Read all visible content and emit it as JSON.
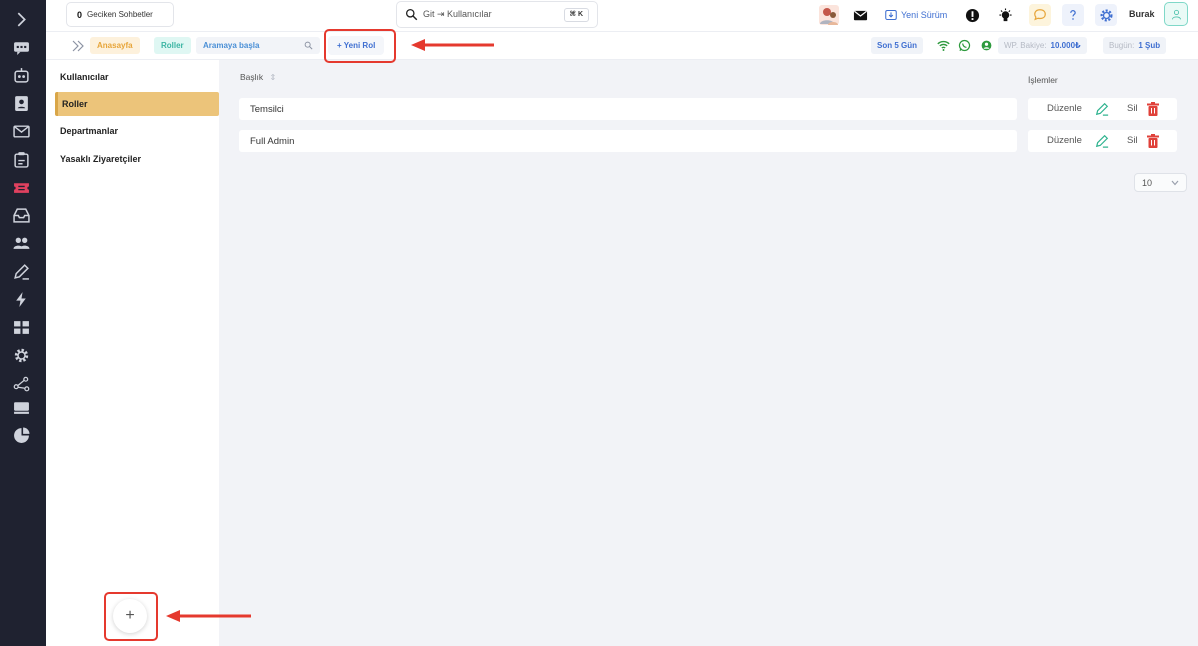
{
  "topbar": {
    "late_chats_count": "0",
    "late_chats_label": "Geciken Sohbetler",
    "search_placeholder": "Git ⇥ Kullanıcılar",
    "search_shortcut": "⌘ K",
    "new_version_label": "Yeni Sürüm",
    "user_name": "Burak"
  },
  "breadcrumb": {
    "home": "Anasayfa",
    "current": "Roller",
    "search_placeholder": "Aramaya başla",
    "new_role_label": "+ Yeni Rol",
    "period": "Son 5 Gün",
    "balance_label": "WP. Bakiye:",
    "balance_value": "10.000₺",
    "today_label": "Bugün:",
    "today_value": "1 Şub"
  },
  "sidebar": {
    "items": [
      {
        "label": "Kullanıcılar",
        "active": false
      },
      {
        "label": "Roller",
        "active": true
      },
      {
        "label": "Departmanlar",
        "active": false
      },
      {
        "label": "Yasaklı Ziyaretçiler",
        "active": false
      }
    ],
    "add_button": "+"
  },
  "table": {
    "col_title": "Başlık",
    "col_actions": "İşlemler",
    "rows": [
      {
        "title": "Temsilci",
        "edit": "Düzenle",
        "delete": "Sil"
      },
      {
        "title": "Full Admin",
        "edit": "Düzenle",
        "delete": "Sil"
      }
    ],
    "page_size": "10"
  },
  "colors": {
    "rail_bg": "#1f2230",
    "active_item": "#ecc47a",
    "accent_blue": "#3f6fd1",
    "highlight_red": "#e5392e",
    "delete_red": "#e0413a",
    "edit_green": "#2fb38f"
  },
  "icons": {
    "rail": [
      "chevron-right-icon",
      "chat-icon",
      "robot-icon",
      "contact-card-icon",
      "mail-icon",
      "clipboard-icon",
      "ticket-icon",
      "inbox-icon",
      "users-icon",
      "pen-icon",
      "bolt-icon",
      "grid-icon",
      "gear-icon",
      "share-icon",
      "keyboard-icon",
      "pie-chart-icon"
    ],
    "topbar": [
      "avatar-group-icon",
      "mail-icon",
      "download-icon",
      "alert-icon",
      "bulb-icon",
      "chat-bubble-icon",
      "question-icon",
      "gear-icon",
      "user-icon"
    ]
  }
}
